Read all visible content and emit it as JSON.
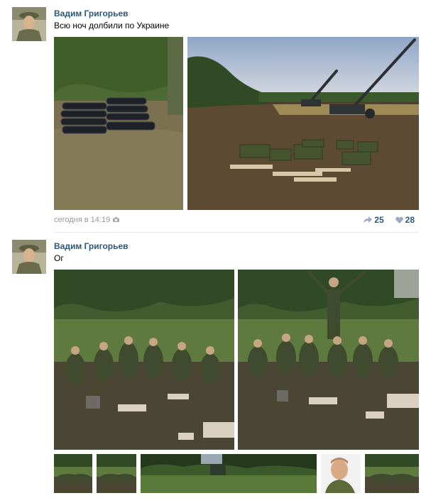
{
  "posts": [
    {
      "author": "Вадим Григорьев",
      "text": "Всю ноч долбили по Украине",
      "timestamp": "сегодня в 14:19",
      "reposts": "25",
      "likes": "28"
    },
    {
      "author": "Вадим Григорьев",
      "text": "Ог"
    }
  ],
  "colors": {
    "link": "#2b587a",
    "meta": "#999999",
    "divider": "#e7e8ec"
  },
  "icons": [
    "camera-icon",
    "repost-icon",
    "heart-icon"
  ]
}
